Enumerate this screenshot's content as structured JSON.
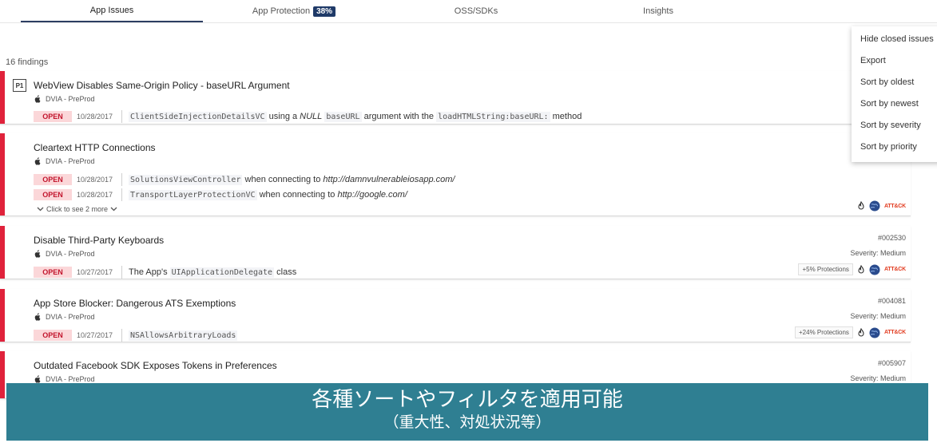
{
  "tabs": [
    {
      "label": "App Issues",
      "active": true
    },
    {
      "label": "App Protection",
      "badge": "38%"
    },
    {
      "label": "OSS/SDKs"
    },
    {
      "label": "Insights"
    }
  ],
  "findings_count": "16 findings",
  "menu": {
    "items": [
      "Hide closed issues",
      "Export",
      "Sort by oldest",
      "Sort by newest",
      "Sort by severity",
      "Sort by priority"
    ]
  },
  "cards": [
    {
      "priority": "P1",
      "title": "WebView Disables Same-Origin Policy - baseURL Argument",
      "app": "DVIA - PreProd",
      "occurrences": [
        {
          "status": "OPEN",
          "date": "10/28/2017",
          "code1": "ClientSideInjectionDetailsVC",
          "t1": " using a ",
          "t2": "NULL",
          "code2": "baseURL",
          "t3": " argument with the ",
          "code3": "loadHTMLString:baseURL:",
          "t4": " method"
        }
      ]
    },
    {
      "title": "Cleartext HTTP Connections",
      "app": "DVIA - PreProd",
      "occurrences": [
        {
          "status": "OPEN",
          "date": "10/28/2017",
          "code": "SolutionsViewController",
          "text": " when connecting to ",
          "url": "http://damnvulnerableiosapp.com/"
        },
        {
          "status": "OPEN",
          "date": "10/28/2017",
          "code": "TransportLayerProtectionVC",
          "text": " when connecting to ",
          "url": "http://google.com/"
        }
      ],
      "more": "Click to see 2 more",
      "attck": "ATT&CK"
    },
    {
      "title": "Disable Third-Party Keyboards",
      "app": "DVIA - PreProd",
      "id": "#002530",
      "severity": "Severity: Medium",
      "protections": "+5% Protections",
      "attck": "ATT&CK",
      "occurrences": [
        {
          "status": "OPEN",
          "date": "10/27/2017",
          "pre": "The App's ",
          "code": "UIApplicationDelegate",
          "post": " class"
        }
      ]
    },
    {
      "title": "App Store Blocker: Dangerous ATS Exemptions",
      "app": "DVIA - PreProd",
      "id": "#004081",
      "severity": "Severity: Medium",
      "protections": "+24% Protections",
      "attck": "ATT&CK",
      "occurrences": [
        {
          "status": "OPEN",
          "date": "10/27/2017",
          "code": "NSAllowsArbitraryLoads"
        }
      ]
    },
    {
      "title": "Outdated Facebook SDK Exposes Tokens in Preferences",
      "app": "DVIA - PreProd",
      "id": "#005907",
      "severity": "Severity: Medium"
    }
  ],
  "banner": {
    "main": "各種ソートやフィルタを適用可能",
    "sub": "（重大性、対処状況等）"
  }
}
